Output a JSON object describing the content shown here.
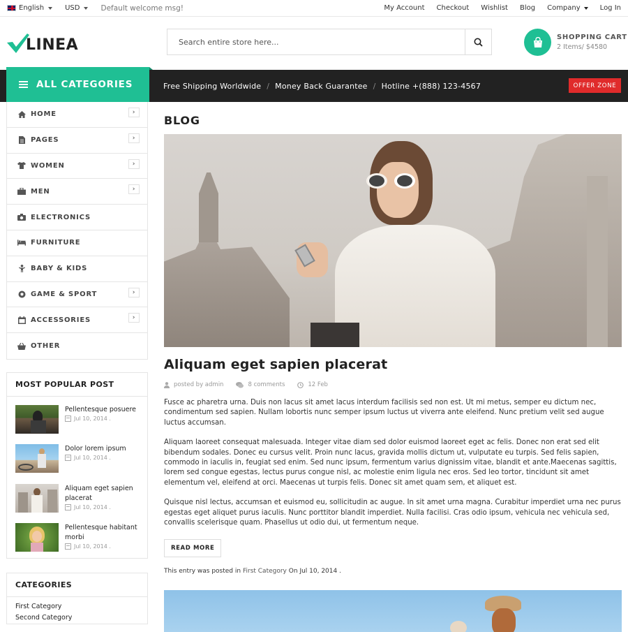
{
  "topbar": {
    "language": "English",
    "currency": "USD",
    "welcome": "Default welcome msg!",
    "links": [
      "My Account",
      "Checkout",
      "Wishlist",
      "Blog",
      "Company",
      "Log In"
    ]
  },
  "header": {
    "logo_text": "LINEA",
    "search_placeholder": "Search entire store here...",
    "cart_title": "SHOPPING CART",
    "cart_summary": "2 Items/ $4580"
  },
  "nav": {
    "all_categories": "ALL CATEGORIES",
    "promos": [
      "Free Shipping Worldwide",
      "Money Back Guarantee",
      "Hotline +(888) 123-4567"
    ],
    "separator": "/",
    "offer": "OFFER ZONE"
  },
  "sidebar": {
    "menu": [
      {
        "label": "HOME",
        "icon": "home-icon",
        "has_arrow": true
      },
      {
        "label": "PAGES",
        "icon": "file-icon",
        "has_arrow": true
      },
      {
        "label": "WOMEN",
        "icon": "shirt-icon",
        "has_arrow": true
      },
      {
        "label": "MEN",
        "icon": "briefcase-icon",
        "has_arrow": true
      },
      {
        "label": "ELECTRONICS",
        "icon": "camera-icon",
        "has_arrow": false
      },
      {
        "label": "FURNITURE",
        "icon": "bed-icon",
        "has_arrow": false
      },
      {
        "label": "BABY & KIDS",
        "icon": "child-icon",
        "has_arrow": false
      },
      {
        "label": "GAME & SPORT",
        "icon": "ball-icon",
        "has_arrow": true
      },
      {
        "label": "ACCESSORIES",
        "icon": "calendar-icon",
        "has_arrow": true
      },
      {
        "label": "OTHER",
        "icon": "basket-icon",
        "has_arrow": false
      }
    ],
    "popular_title": "MOST POPULAR POST",
    "popular": [
      {
        "title": "Pellentesque posuere",
        "date": "Jul 10, 2014 ."
      },
      {
        "title": "Dolor lorem ipsum",
        "date": "Jul 10, 2014 ."
      },
      {
        "title": "Aliquam eget sapien placerat",
        "date": "Jul 10, 2014 ."
      },
      {
        "title": "Pellentesque habitant morbi",
        "date": "Jul 10, 2014 ."
      }
    ],
    "categories_title": "CATEGORIES",
    "categories": [
      "First Category",
      "Second Category"
    ]
  },
  "main": {
    "heading": "BLOG",
    "post_title": "Aliquam eget sapien placerat",
    "author": "posted by admin",
    "comments": "8 comments",
    "date": "12 Feb",
    "paragraphs": [
      "Fusce ac pharetra urna. Duis non lacus sit amet lacus interdum facilisis sed non est. Ut mi metus, semper eu dictum nec, condimentum sed sapien. Nullam lobortis nunc semper ipsum luctus ut viverra ante eleifend. Nunc pretium velit sed augue luctus accumsan.",
      "Aliquam laoreet consequat malesuada. Integer vitae diam sed dolor euismod laoreet eget ac felis. Donec non erat sed elit bibendum sodales. Donec eu cursus velit. Proin nunc lacus, gravida mollis dictum ut, vulputate eu turpis. Sed felis sapien, commodo in iaculis in, feugiat sed enim. Sed nunc ipsum, fermentum varius dignissim vitae, blandit et ante.Maecenas sagittis, lorem sed congue egestas, lectus purus congue nisl, ac molestie enim ligula nec eros. Sed leo tortor, tincidunt sit amet elementum vel, eleifend at orci. Maecenas ut turpis felis. Donec sit amet quam sem, et aliquet est.",
      "Quisque nisl lectus, accumsan et euismod eu, sollicitudin ac augue. In sit amet urna magna. Curabitur imperdiet urna nec purus egestas eget aliquet purus iaculis. Nunc porttitor blandit imperdiet. Nulla facilisi. Cras odio ipsum, vehicula nec vehicula sed, convallis scelerisque quam. Phasellus ut odio dui, ut fermentum neque."
    ],
    "read_more": "READ MORE",
    "entry_prefix": "This entry was posted in",
    "entry_category": "First Category",
    "entry_on": "On",
    "entry_date": "Jul 10, 2014",
    "entry_suffix": "."
  },
  "colors": {
    "accent": "#1fbf94",
    "dark": "#222222",
    "offer": "#e02b2b"
  }
}
